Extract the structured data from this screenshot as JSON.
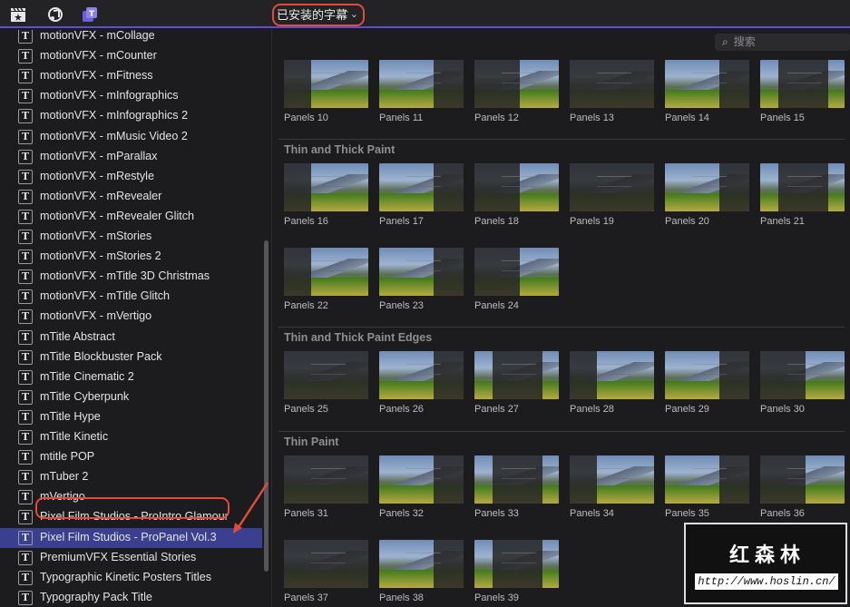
{
  "topbar": {
    "dropdown_label": "已安装的字幕",
    "dropdown_chevron": "⌃⌄"
  },
  "search": {
    "placeholder": "搜索"
  },
  "sidebar": {
    "items": [
      "motionVFX - mCollage",
      "motionVFX - mCounter",
      "motionVFX - mFitness",
      "motionVFX - mInfographics",
      "motionVFX - mInfographics 2",
      "motionVFX - mMusic Video 2",
      "motionVFX - mParallax",
      "motionVFX - mRestyle",
      "motionVFX - mRevealer",
      "motionVFX - mRevealer Glitch",
      "motionVFX - mStories",
      "motionVFX - mStories 2",
      "motionVFX - mTitle 3D Christmas",
      "motionVFX - mTitle Glitch",
      "motionVFX - mVertigo",
      "mTitle Abstract",
      "mTitle Blockbuster Pack",
      "mTitle Cinematic 2",
      "mTitle Cyberpunk",
      "mTitle Hype",
      "mTitle Kinetic",
      "mtitle POP",
      "mTuber 2",
      "mVertigo",
      "Pixel Film Studios - ProIntro Glamour",
      "Pixel Film Studios - ProPanel Vol.3",
      "PremiumVFX Essential Stories",
      "Typographic Kinetic Posters Titles",
      "Typography Pack Title"
    ],
    "selected_index": 25,
    "item_icon": "T"
  },
  "sections": [
    "Thin and Thick Paint",
    "Thin and Thick Paint Edges",
    "Thin Paint"
  ],
  "thumbs": [
    "Panels 10",
    "Panels 11",
    "Panels 12",
    "Panels 13",
    "Panels 14",
    "Panels 15",
    "Panels 16",
    "Panels 17",
    "Panels 18",
    "Panels 19",
    "Panels 20",
    "Panels 21",
    "Panels 22",
    "Panels 23",
    "Panels 24",
    "Panels 25",
    "Panels 26",
    "Panels 27",
    "Panels 28",
    "Panels 29",
    "Panels 30",
    "Panels 31",
    "Panels 32",
    "Panels 33",
    "Panels 34",
    "Panels 35",
    "Panels 36",
    "Panels 37",
    "Panels 38",
    "Panels 39"
  ],
  "watermark": {
    "title": "红森林",
    "url": "http://www.hoslin.cn/"
  },
  "colors": {
    "accent": "#5b4fd0",
    "selection": "#3a3f8f",
    "annotation": "#e14b3a"
  }
}
